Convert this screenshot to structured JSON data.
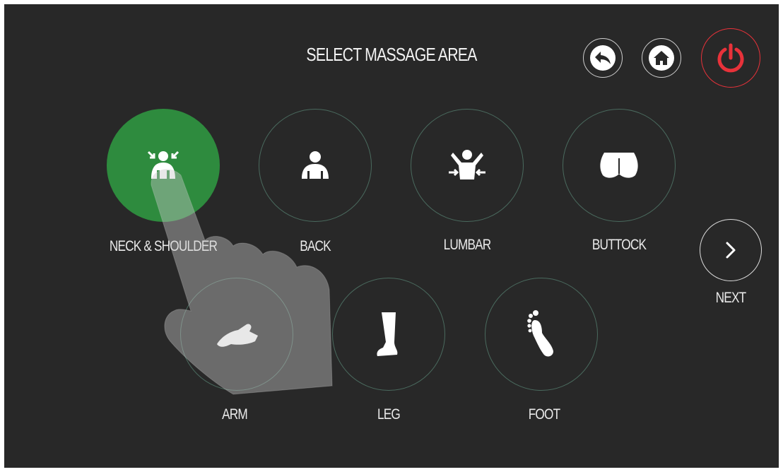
{
  "header": {
    "title": "SELECT MASSAGE AREA",
    "back_icon": "back-arrow-icon",
    "home_icon": "home-icon",
    "power_icon": "power-icon",
    "power_color": "#e8323a"
  },
  "areas": [
    {
      "label": "NECK & SHOULDER",
      "icon": "neck-shoulder-icon",
      "selected": true
    },
    {
      "label": "BACK",
      "icon": "back-icon",
      "selected": false
    },
    {
      "label": "LUMBAR",
      "icon": "lumbar-icon",
      "selected": false
    },
    {
      "label": "BUTTOCK",
      "icon": "buttock-icon",
      "selected": false
    },
    {
      "label": "ARM",
      "icon": "arm-icon",
      "selected": false
    },
    {
      "label": "LEG",
      "icon": "leg-icon",
      "selected": false
    },
    {
      "label": "FOOT",
      "icon": "foot-icon",
      "selected": false
    }
  ],
  "next": {
    "label": "NEXT",
    "icon": "chevron-right-icon"
  },
  "colors": {
    "background": "#282828",
    "selected": "#2e8b3e",
    "ring": "#4a6a5e"
  }
}
